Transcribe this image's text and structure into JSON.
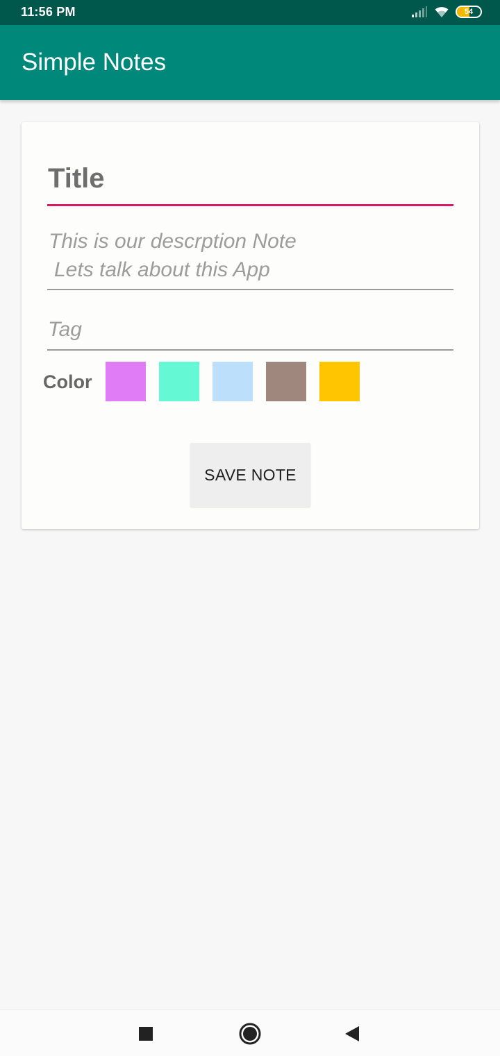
{
  "status_bar": {
    "time": "11:56 PM",
    "battery": "54",
    "battery_level": 0.54,
    "icons": [
      "signal-icon",
      "wifi-icon",
      "battery-icon"
    ]
  },
  "app_bar": {
    "title": "Simple Notes"
  },
  "form": {
    "title_placeholder": "Title",
    "description_line_1": "This is our descrption Note",
    "description_line_2": "Lets talk about this App",
    "tag_placeholder": "Tag",
    "color_label": "Color",
    "colors": [
      "#e07cf6",
      "#64f8d4",
      "#bcdffb",
      "#a0877d",
      "#ffc500"
    ],
    "save_label": "SAVE NOTE"
  },
  "nav_bar": {
    "icons": [
      "recents-square-icon",
      "home-circle-icon",
      "back-triangle-icon"
    ]
  },
  "theme": {
    "primary": "#00897b",
    "primary_dark": "#00574b",
    "accent": "#d81b60"
  }
}
